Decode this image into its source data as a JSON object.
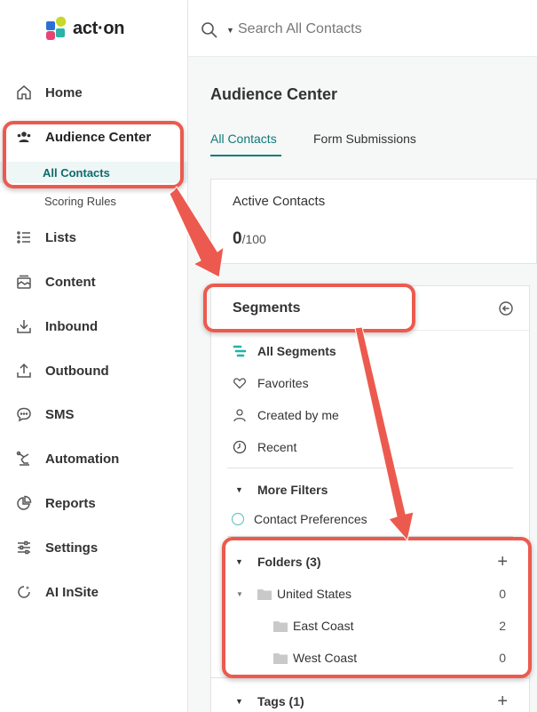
{
  "app": {
    "logo_text": "act·on"
  },
  "search": {
    "placeholder": "Search All Contacts"
  },
  "sidebar": {
    "items": [
      {
        "label": "Home"
      },
      {
        "label": "Audience Center"
      },
      {
        "label": "Lists"
      },
      {
        "label": "Content"
      },
      {
        "label": "Inbound"
      },
      {
        "label": "Outbound"
      },
      {
        "label": "SMS"
      },
      {
        "label": "Automation"
      },
      {
        "label": "Reports"
      },
      {
        "label": "Settings"
      },
      {
        "label": "AI InSite"
      }
    ],
    "sub_items": [
      {
        "label": "All Contacts",
        "active": true
      },
      {
        "label": "Scoring Rules",
        "active": false
      }
    ]
  },
  "main": {
    "title": "Audience Center",
    "tabs": [
      {
        "label": "All Contacts",
        "active": true
      },
      {
        "label": "Form Submissions",
        "active": false
      }
    ],
    "active_contacts": {
      "title": "Active Contacts",
      "count": "0",
      "limit": "/100"
    },
    "segments": {
      "title": "Segments",
      "filters": [
        {
          "label": "All Segments",
          "icon": "segments-icon"
        },
        {
          "label": "Favorites",
          "icon": "heart-icon"
        },
        {
          "label": "Created by me",
          "icon": "user-icon"
        },
        {
          "label": "Recent",
          "icon": "clock-icon"
        }
      ],
      "more_filters": {
        "label": "More Filters",
        "items": [
          {
            "label": "Contact Preferences"
          }
        ]
      },
      "folders": {
        "label": "Folders (3)",
        "items": [
          {
            "label": "United States",
            "count": "0",
            "level": 0
          },
          {
            "label": "East Coast",
            "count": "2",
            "level": 1
          },
          {
            "label": "West Coast",
            "count": "0",
            "level": 1
          }
        ]
      },
      "tags": {
        "label": "Tags (1)"
      }
    }
  },
  "colors": {
    "accent": "#0f7a7a",
    "annotation": "#ec5a4f"
  }
}
